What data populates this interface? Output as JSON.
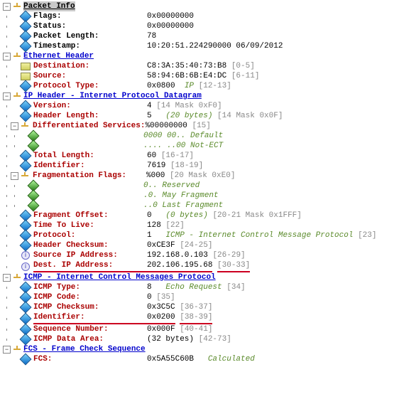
{
  "packet_info": {
    "title": "Packet Info",
    "flags": {
      "label": "Flags:",
      "value": "0x00000000"
    },
    "status": {
      "label": "Status:",
      "value": "0x00000000"
    },
    "packet_length": {
      "label": "Packet Length:",
      "value": "78"
    },
    "timestamp": {
      "label": "Timestamp:",
      "value": "10:20:51.224290000 06/09/2012"
    }
  },
  "ethernet": {
    "title": "Ethernet Header",
    "destination": {
      "label": "Destination:",
      "value": "C8:3A:35:40:73:B8",
      "annot": "[0-5]"
    },
    "source": {
      "label": "Source:",
      "value": "58:94:6B:6B:E4:DC",
      "annot": "[6-11]"
    },
    "protocol_type": {
      "label": "Protocol Type:",
      "value": "0x0800",
      "proto": "IP",
      "annot": "[12-13]"
    }
  },
  "ip": {
    "title": "IP Header - Internet Protocol Datagram",
    "version": {
      "label": "Version:",
      "value": "4",
      "annot": "[14 Mask 0xF0]"
    },
    "header_length": {
      "label": "Header Length:",
      "value": "5",
      "comment": "(20 bytes)",
      "annot": "[14 Mask 0x0F]"
    },
    "ds": {
      "label": "Differentiated Services:",
      "value": "%00000000",
      "annot": "[15]",
      "a": {
        "bits": "0000 00..",
        "text": "Default"
      },
      "b": {
        "bits": ".... ..00",
        "text": "Not-ECT"
      }
    },
    "total_length": {
      "label": "Total Length:",
      "value": "60",
      "annot": "[16-17]"
    },
    "identifier": {
      "label": "Identifier:",
      "value": "7619",
      "annot": "[18-19]"
    },
    "frag_flags": {
      "label": "Fragmentation Flags:",
      "value": "%000",
      "annot": "[20 Mask 0xE0]",
      "a": {
        "bits": "0..",
        "text": "Reserved"
      },
      "b": {
        "bits": ".0.",
        "text": "May Fragment"
      },
      "c": {
        "bits": "..0",
        "text": "Last Fragment"
      }
    },
    "frag_offset": {
      "label": "Fragment Offset:",
      "value": "0",
      "comment": "(0 bytes)",
      "annot": "[20-21 Mask 0x1FFF]"
    },
    "ttl": {
      "label": "Time To Live:",
      "value": "128",
      "annot": "[22]"
    },
    "protocol": {
      "label": "Protocol:",
      "value": "1",
      "proto": "ICMP - Internet Control Message Protocol",
      "annot": "[23]"
    },
    "checksum": {
      "label": "Header Checksum:",
      "value": "0xCE3F",
      "annot": "[24-25]"
    },
    "src_ip": {
      "label": "Source IP Address:",
      "value": "192.168.0.103",
      "annot": "[26-29]"
    },
    "dst_ip": {
      "label": "Dest. IP Address:",
      "value": "202.106.195.68",
      "annot": "[30-33]"
    }
  },
  "icmp": {
    "title": "ICMP - Internet Control Messages Protocol",
    "type": {
      "label": "ICMP Type:",
      "value": "8",
      "proto": "Echo Request",
      "annot": "[34]"
    },
    "code": {
      "label": "ICMP Code:",
      "value": "0",
      "annot": "[35]"
    },
    "checksum": {
      "label": "ICMP Checksum:",
      "value": "0x3C5C",
      "annot": "[36-37]"
    },
    "identifier": {
      "label": "Identifier:",
      "value": "0x0200",
      "annot": "[38-39]"
    },
    "seq": {
      "label": "Sequence Number:",
      "value": "0x000F",
      "annot": "[40-41]"
    },
    "data": {
      "label": "ICMP Data Area:",
      "value": "(32 bytes)",
      "annot": "[42-73]"
    }
  },
  "fcs": {
    "title": "FCS - Frame Check Sequence",
    "fcs": {
      "label": "FCS:",
      "value": "0x5A55C60B",
      "proto": "Calculated"
    }
  }
}
